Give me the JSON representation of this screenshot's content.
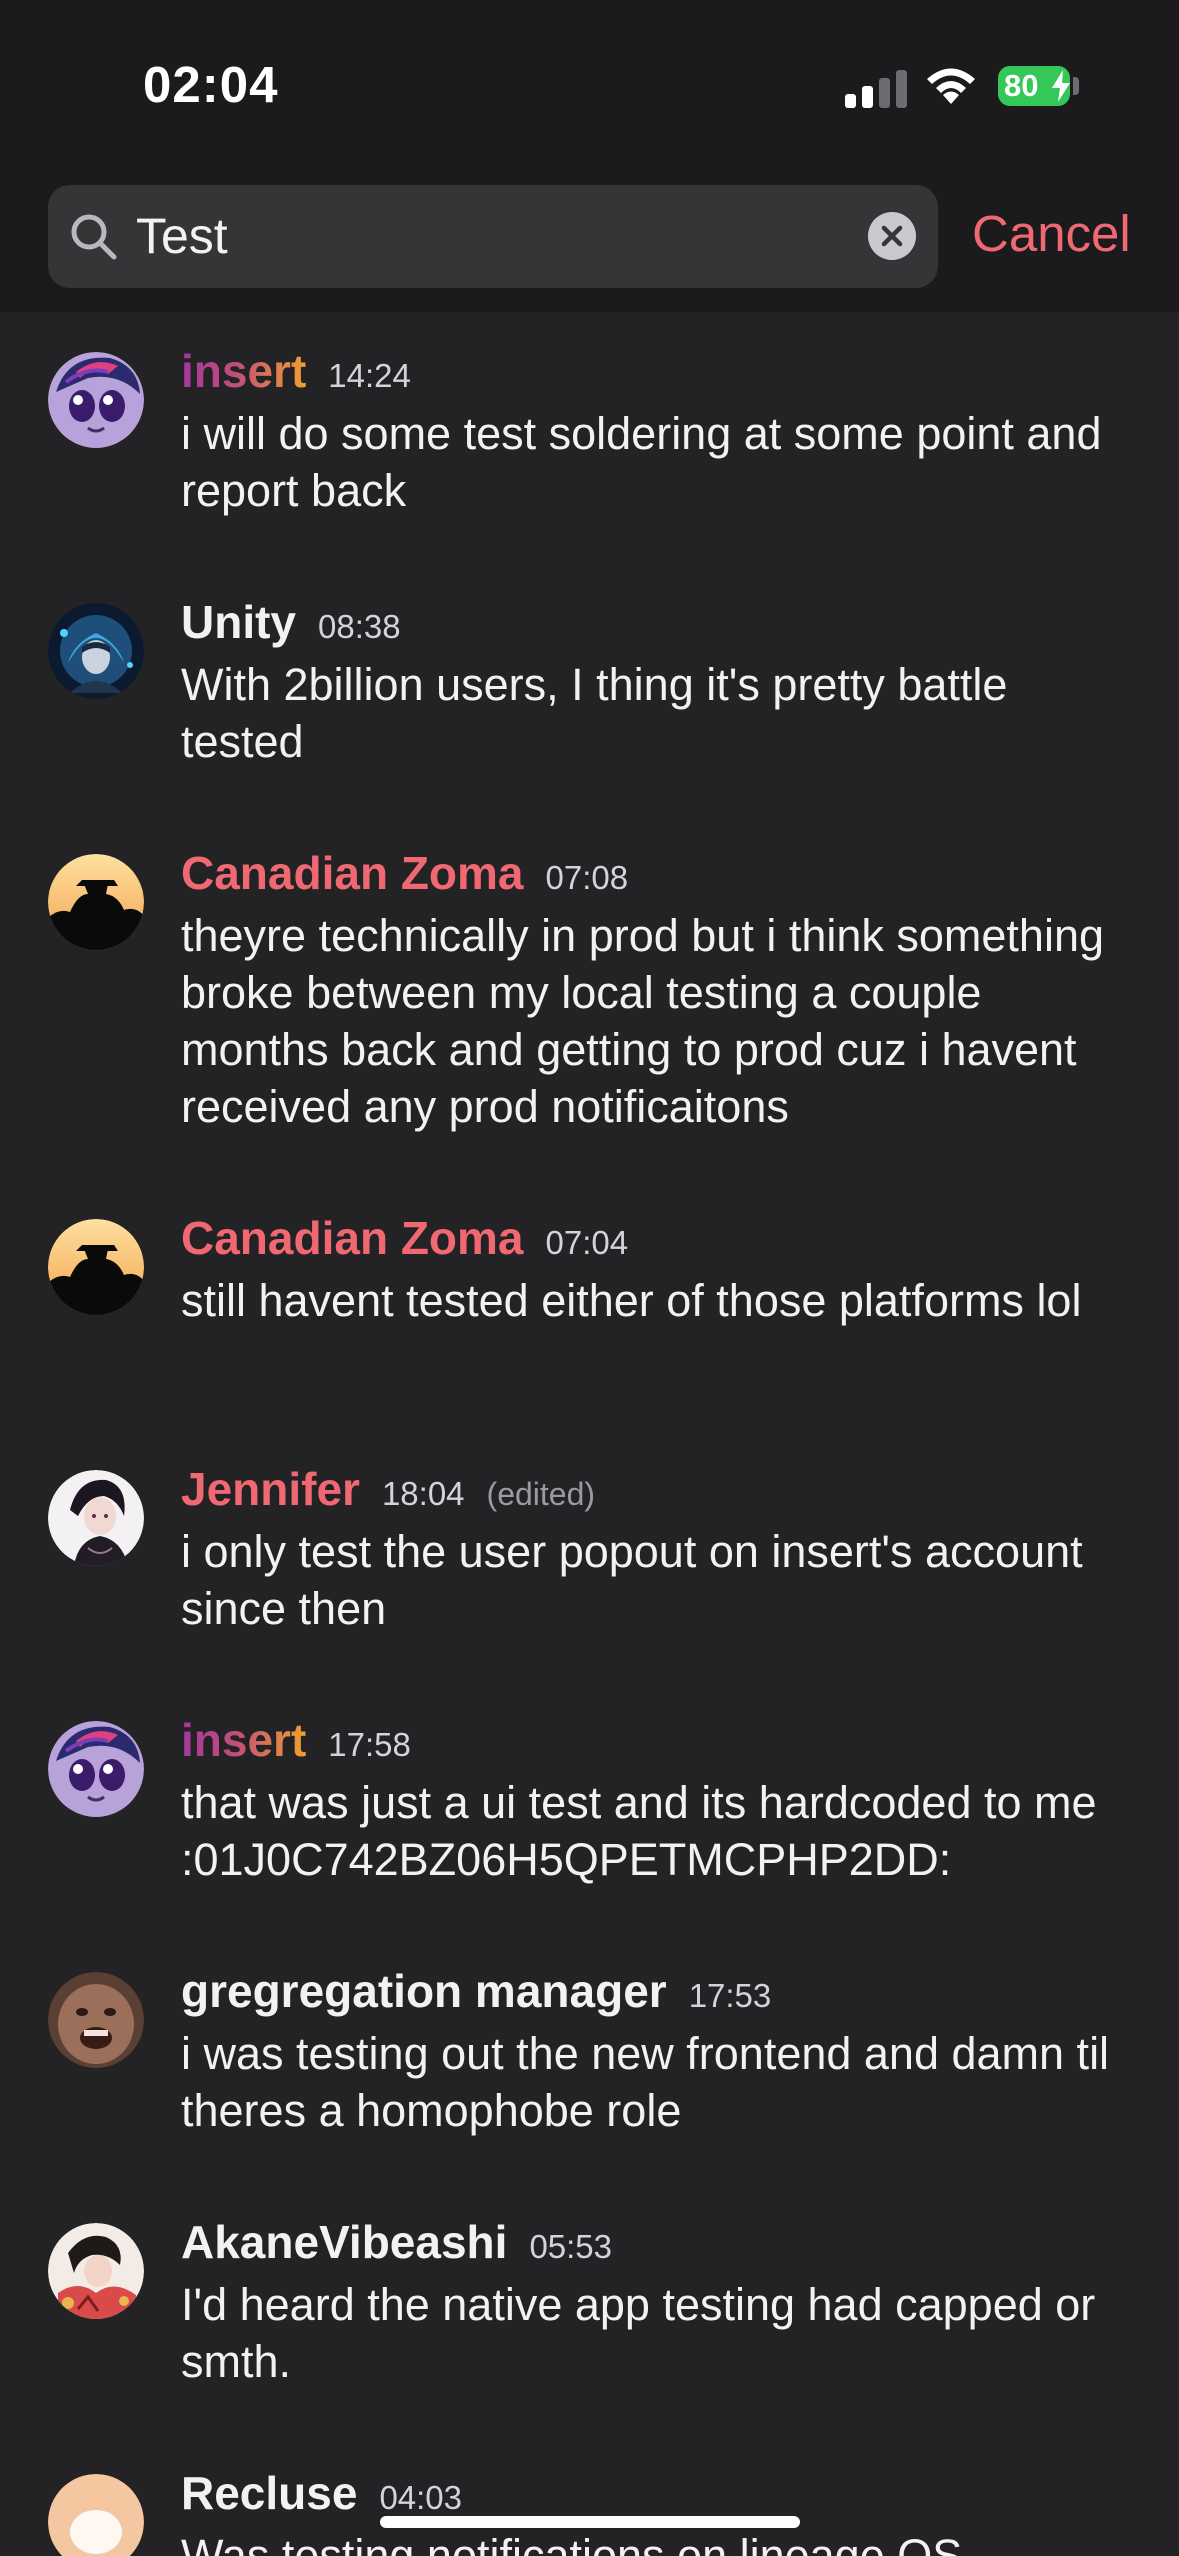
{
  "status_bar": {
    "time": "02:04",
    "battery": "80"
  },
  "search": {
    "query": "Test",
    "cancel_label": "Cancel"
  },
  "colors": {
    "accent": "#f06872",
    "background": "#232325",
    "header": "#1b1b1d"
  },
  "messages": [
    {
      "author": "insert",
      "time": "14:24",
      "edited": "",
      "text": "i will do some test soldering at some point and report back",
      "avatar": "pony-avatar"
    },
    {
      "author": "Unity",
      "time": "08:38",
      "edited": "",
      "text": "With 2billion users, I thing it's pretty battle tested",
      "avatar": "blue-hooded-avatar"
    },
    {
      "author": "Canadian Zoma",
      "time": "07:08",
      "edited": "",
      "text": "theyre technically in prod but i think something broke between my local testing a couple months back and getting to prod cuz i havent received any prod notificaitons",
      "avatar": "silhouette-avatar"
    },
    {
      "author": "Canadian Zoma",
      "time": "07:04",
      "edited": "",
      "text": "still havent tested either of those platforms lol",
      "avatar": "silhouette-avatar"
    },
    {
      "author": "Jennifer",
      "time": "18:04",
      "edited": "(edited)",
      "text": "i only test the user popout on insert's account since then",
      "avatar": "anime-portrait-avatar"
    },
    {
      "author": "insert",
      "time": "17:58",
      "edited": "",
      "text": "that was just a ui test and its hardcoded to me :01J0C742BZ06H5QPETMCPHP2DD:",
      "avatar": "pony-avatar"
    },
    {
      "author": "gregregation manager",
      "time": "17:53",
      "edited": "",
      "text": "i was testing out the new frontend and damn til theres a homophobe role",
      "avatar": "face-avatar"
    },
    {
      "author": "AkaneVibeashi",
      "time": "05:53",
      "edited": "",
      "text": "I'd heard the native app testing had capped or smth.",
      "avatar": "manga-avatar"
    },
    {
      "author": "Recluse",
      "time": "04:03",
      "edited": "",
      "text": "Was testing notifications on lineage OS",
      "avatar": "blob-avatar"
    }
  ]
}
